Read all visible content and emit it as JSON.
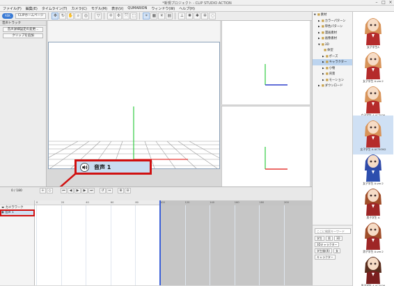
{
  "window": {
    "title": "*新規プロジェクト - CLIP STUDIO ACTION",
    "minimize": "–",
    "maximize": "□",
    "close": "×"
  },
  "menu": [
    "ファイル(F)",
    "編集(E)",
    "タイムライン(T)",
    "カメラ(C)",
    "モデル(M)",
    "表示(V)",
    "QUMARION",
    "ウィンドウ(W)",
    "ヘルプ(H)"
  ],
  "toolbar": {
    "pill1": "ASK",
    "pill2": "CLIPホームページ"
  },
  "left_panel": {
    "header": "音声トラック",
    "button1": "音声詳細設定の変更...",
    "button2": "クリップを追加"
  },
  "callout": {
    "label": "音声 1"
  },
  "timeline": {
    "frame_counter": "0 / 180",
    "ruler_ticks": [
      "0",
      "20",
      "40",
      "60",
      "80",
      "100",
      "120",
      "140",
      "160",
      "180",
      "200"
    ],
    "playhead_frame": 100,
    "tracks": [
      {
        "label": "カメラワーク",
        "selected": false
      },
      {
        "label": "音声 1",
        "selected": true
      }
    ]
  },
  "tree": {
    "nodes": [
      {
        "label": "素材",
        "expander": "▼"
      },
      {
        "label": "カラーパターン",
        "expander": "▶"
      },
      {
        "label": "単色パターン",
        "expander": "▶"
      },
      {
        "label": "漫画素材",
        "expander": "▶"
      },
      {
        "label": "画像素材",
        "expander": "▶"
      },
      {
        "label": "3D",
        "expander": "▼"
      },
      {
        "label": "体型",
        "expander": ""
      },
      {
        "label": "ポーズ",
        "expander": "▶"
      },
      {
        "label": "キャラクター",
        "expander": "▶"
      },
      {
        "label": "小物",
        "expander": "▶"
      },
      {
        "label": "背景",
        "expander": "▶"
      },
      {
        "label": "モーション",
        "expander": "▶"
      },
      {
        "label": "ダウンロード",
        "expander": "▶"
      }
    ]
  },
  "search": {
    "placeholder": "ここに検索キーワード",
    "tags": [
      "学生",
      "男",
      "3D",
      "3Dキャラクター",
      "学生服(男)",
      "女",
      "キャラクター"
    ]
  },
  "thumbnails": [
    {
      "caption": "女子学生A",
      "hair": "#d8945a",
      "body": "#b52b2b",
      "selected": false
    },
    {
      "caption": "女子学生 A-ver.2",
      "hair": "#d8945a",
      "body": "#b52b2b",
      "selected": false
    },
    {
      "caption": "女子学生 A ACTION",
      "hair": "#d8945a",
      "body": "#b52b2b",
      "selected": false
    },
    {
      "caption": "女子学生 A ACTION2",
      "hair": "#d8945a",
      "body": "#b52b2b",
      "selected": true
    },
    {
      "caption": "女子学生 A-ver.2",
      "hair": "#2f4aa8",
      "body": "#2d4fae",
      "selected": false
    },
    {
      "caption": "男子学生 A",
      "hair": "#a04e2a",
      "body": "#9e2626",
      "selected": false
    },
    {
      "caption": "男子学生 A-ver.2",
      "hair": "#a04e2a",
      "body": "#9e2626",
      "selected": false
    },
    {
      "caption": "男子学生 A ACTION",
      "hair": "#5a2e1e",
      "body": "#7a1f1f",
      "selected": false
    }
  ],
  "colors": {
    "accent": "#3a7bd5",
    "highlight": "#d01010",
    "selection": "#cfe0f4",
    "playhead": "#3a5fd8"
  }
}
